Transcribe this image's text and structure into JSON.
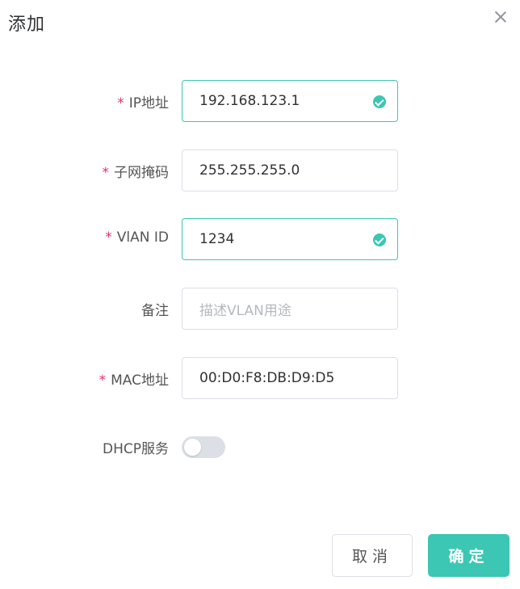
{
  "dialog": {
    "title": "添加"
  },
  "fields": {
    "ip": {
      "label": "IP地址",
      "value": "192.168.123.1",
      "required": "*",
      "status": "check-circle-icon"
    },
    "mask": {
      "label": "子网掩码",
      "value": "255.255.255.0",
      "required": "*"
    },
    "vlan": {
      "label": "VlAN ID",
      "value": "1234",
      "required": "*",
      "status": "check-circle-icon"
    },
    "remark": {
      "label": "备注",
      "value": "",
      "placeholder": "描述VLAN用途"
    },
    "mac": {
      "label": "MAC地址",
      "value": "00:D0:F8:DB:D9:D5",
      "required": "*"
    },
    "dhcp": {
      "label": "DHCP服务",
      "enabled": false
    }
  },
  "buttons": {
    "cancel": "取消",
    "confirm": "确定"
  },
  "colors": {
    "accent": "#3bc7b4",
    "required": "#e8336b"
  }
}
